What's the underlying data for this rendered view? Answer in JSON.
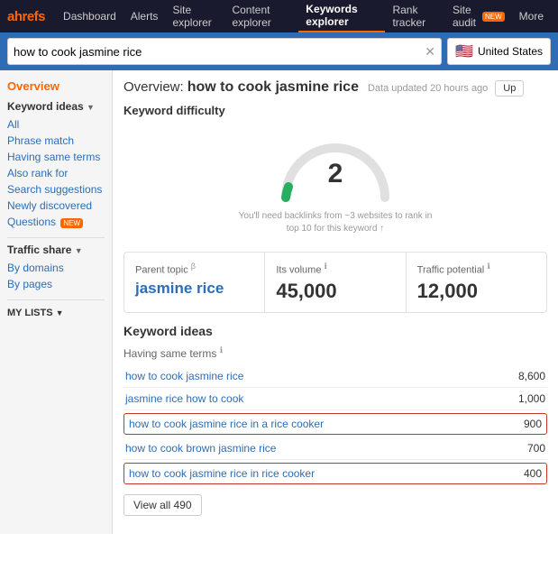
{
  "nav": {
    "logo": "ahrefs",
    "items": [
      {
        "label": "Dashboard",
        "active": false
      },
      {
        "label": "Alerts",
        "active": false
      },
      {
        "label": "Site explorer",
        "active": false
      },
      {
        "label": "Content explorer",
        "active": false
      },
      {
        "label": "Keywords explorer",
        "active": true
      },
      {
        "label": "Rank tracker",
        "active": false
      },
      {
        "label": "Site audit",
        "active": false,
        "badge": "NEW"
      },
      {
        "label": "More",
        "active": false
      }
    ]
  },
  "search": {
    "query": "how to cook jasmine rice",
    "country": "United States"
  },
  "sidebar": {
    "overview_label": "Overview",
    "keyword_ideas_label": "Keyword ideas",
    "links": [
      {
        "label": "All",
        "active": false
      },
      {
        "label": "Phrase match",
        "active": false
      },
      {
        "label": "Having same terms",
        "active": false
      },
      {
        "label": "Also rank for",
        "active": false
      },
      {
        "label": "Search suggestions",
        "active": false
      },
      {
        "label": "Newly discovered",
        "active": false
      },
      {
        "label": "Questions",
        "active": false,
        "badge": "NEW"
      }
    ],
    "traffic_share_label": "Traffic share",
    "traffic_links": [
      {
        "label": "By domains"
      },
      {
        "label": "By pages"
      }
    ],
    "my_lists_label": "MY LISTS"
  },
  "overview": {
    "title": "Overview:",
    "keyword": "how to cook jasmine rice",
    "data_updated": "Data updated 20 hours ago",
    "update_btn": "Up",
    "kd_label": "Keyword difficulty",
    "kd_value": "2",
    "kd_note": "You'll need backlinks from ~3 websites to rank in top 10 for this keyword ↑",
    "parent_topic_label": "Parent topic",
    "parent_topic_value": "jasmine rice",
    "volume_label": "Its volume",
    "volume_value": "45,000",
    "traffic_potential_label": "Traffic potential",
    "traffic_potential_value": "12,000",
    "keyword_ideas_label": "Keyword ideas",
    "having_same_terms_label": "Having same terms",
    "keyword_rows": [
      {
        "keyword": "how to cook jasmine rice",
        "count": "8,600",
        "highlighted": false
      },
      {
        "keyword": "jasmine rice how to cook",
        "count": "1,000",
        "highlighted": false
      },
      {
        "keyword": "how to cook jasmine rice in a rice cooker",
        "count": "900",
        "highlighted": true
      },
      {
        "keyword": "how to cook brown jasmine rice",
        "count": "700",
        "highlighted": false
      },
      {
        "keyword": "how to cook jasmine rice in rice cooker",
        "count": "400",
        "highlighted": true
      }
    ],
    "view_all_label": "View all 490"
  }
}
